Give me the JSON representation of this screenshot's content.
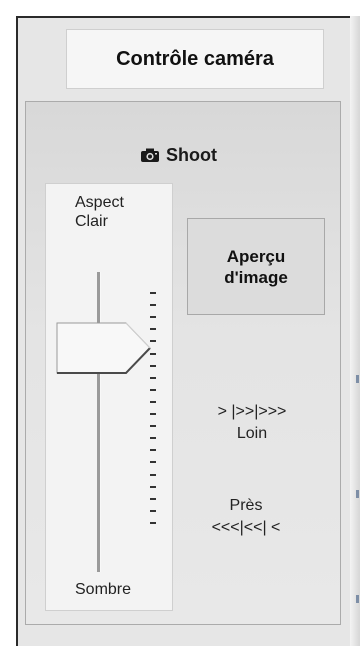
{
  "title": "Contrôle caméra",
  "shoot": {
    "label": "Shoot",
    "icon": "camera-icon"
  },
  "brightness": {
    "top_label_line1": "Aspect",
    "top_label_line2": "Clair",
    "bottom_label": "Sombre",
    "value_fraction": 0.75
  },
  "preview": {
    "line1": "Aperçu",
    "line2": "d'image"
  },
  "focus": {
    "far_arrows": "> |>>|>>>",
    "far_label": "Loin",
    "near_label": "Près",
    "near_arrows": "<<<|<<| <"
  }
}
